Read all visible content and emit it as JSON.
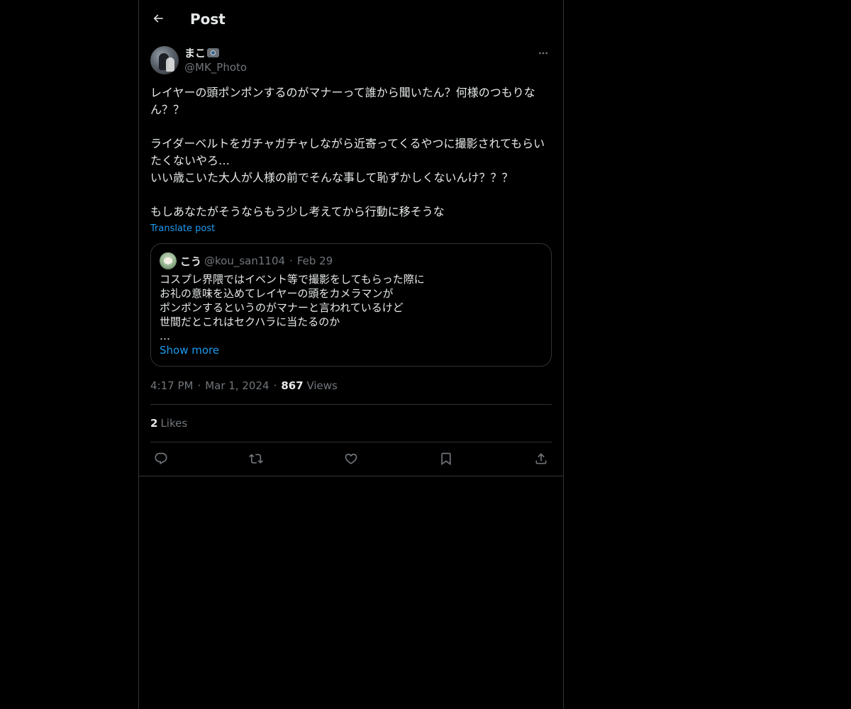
{
  "header": {
    "title": "Post",
    "back_icon": "arrow-left-icon"
  },
  "post": {
    "author": {
      "name": "まこ",
      "name_emoji": "camera-flash-emoji",
      "handle": "@MK_Photo"
    },
    "text": "レイヤーの頭ポンポンするのがマナーって誰から聞いたん？何様のつもりなん？？\n\nライダーベルトをガチャガチャしながら近寄ってくるやつに撮影されてもらいたくないやろ…\nいい歳こいた大人が人様の前でそんな事して恥ずかしくないんけ？？？\n\nもしあなたがそうならもう少し考えてから行動に移そうな",
    "translate_label": "Translate post",
    "quote": {
      "name": "こう",
      "handle": "@kou_san1104",
      "separator": "·",
      "date": "Feb 29",
      "text": "コスプレ界隈ではイベント等で撮影をしてもらった際に\nお礼の意味を込めてレイヤーの頭をカメラマンが\nポンポンするというのがマナーと言われているけど\n世間だとこれはセクハラに当たるのか\n…",
      "show_more_label": "Show more"
    },
    "meta": {
      "time": "4:17 PM",
      "separator": "·",
      "date": "Mar 1, 2024",
      "views_count": "867",
      "views_label": "Views"
    },
    "likes": {
      "count": "2",
      "label": "Likes"
    },
    "actions": [
      {
        "name": "reply",
        "icon": "reply-icon"
      },
      {
        "name": "repost",
        "icon": "repost-icon"
      },
      {
        "name": "like",
        "icon": "heart-icon"
      },
      {
        "name": "bookmark",
        "icon": "bookmark-icon"
      },
      {
        "name": "share",
        "icon": "share-icon"
      }
    ]
  },
  "colors": {
    "background": "#000000",
    "text": "#e7e9ea",
    "secondary_text": "#71767b",
    "link": "#1d9bf0",
    "border": "#2f3336"
  }
}
